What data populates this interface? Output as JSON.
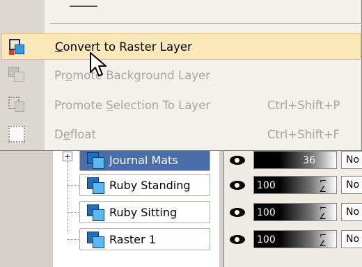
{
  "menu": {
    "items": [
      {
        "label": "Convert to Raster Layer",
        "mnemonic": "C",
        "shortcut": "",
        "enabled": true,
        "highlighted": true,
        "icon": "convert-raster-icon"
      },
      {
        "label": "Promote Background Layer",
        "mnemonic": "o",
        "shortcut": "",
        "enabled": false,
        "highlighted": false,
        "icon": "promote-background-icon"
      },
      {
        "label": "Promote Selection To Layer",
        "mnemonic": "S",
        "shortcut": "Ctrl+Shift+P",
        "enabled": false,
        "highlighted": false,
        "icon": "promote-selection-icon"
      },
      {
        "label": "Defloat",
        "mnemonic": "e",
        "shortcut": "Ctrl+Shift+F",
        "enabled": false,
        "highlighted": false,
        "icon": "defloat-icon"
      }
    ]
  },
  "layers": {
    "rows": [
      {
        "name": "Journal Mats",
        "opacity": "36",
        "blend": "No",
        "selected": true,
        "expandable": true
      },
      {
        "name": "Ruby Standing",
        "opacity": "100",
        "blend": "No",
        "selected": false,
        "expandable": false
      },
      {
        "name": "Ruby Sitting",
        "opacity": "100",
        "blend": "No",
        "selected": false,
        "expandable": false
      },
      {
        "name": "Raster 1",
        "opacity": "100",
        "blend": "No",
        "selected": false,
        "expandable": false
      }
    ]
  },
  "colors": {
    "highlight_bg": "#fae8b8",
    "selected_layer_bg": "#4a6fa8",
    "disabled_text": "#a8a59e"
  }
}
